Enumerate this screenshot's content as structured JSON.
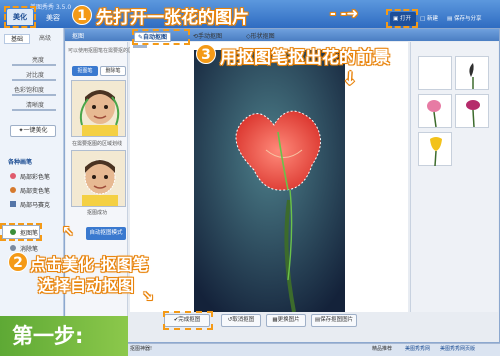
{
  "app": {
    "title": "美图秀秀 3.5.0",
    "open_label": "打开",
    "new_label": "新建",
    "share_label": "保存与分享"
  },
  "top_tabs": [
    {
      "label": "美化"
    },
    {
      "label": "美容"
    }
  ],
  "left_panel": {
    "subtabs": [
      "基础",
      "高级"
    ],
    "sliders": [
      "亮度",
      "对比度",
      "色彩饱和度",
      "清晰度"
    ],
    "one_click_label": "一键美化",
    "section_title": "各种画笔",
    "categories": [
      {
        "label": "局部彩色笔",
        "icon": "brush-icon"
      },
      {
        "label": "局部变色笔",
        "icon": "brush-icon"
      },
      {
        "label": "局部马赛克",
        "icon": "mosaic-icon"
      },
      {
        "label": "抠图笔",
        "icon": "cutout-pen-icon"
      },
      {
        "label": "消除笔",
        "icon": "eraser-icon"
      }
    ]
  },
  "dialog": {
    "title": "抠图",
    "hint": "可以使用抠图笔在需要抠的区域划线",
    "toggles": [
      "抠图笔",
      "删除笔"
    ],
    "sample_caption_1": "在需要抠图的区域划线",
    "sample_caption_2": "抠图成功",
    "auto_cut_label": "自动抠图模式",
    "tool_tabs": [
      "自动抠图",
      "手动抠图",
      "形状抠图"
    ],
    "bottom_buttons": [
      "完成抠图",
      "取消抠图",
      "更换图片",
      "保存抠图图片"
    ]
  },
  "status_bar": {
    "left": "抠图神器!",
    "items": [
      "精品推荐",
      "美图秀秀网",
      "美图秀秀网页版"
    ]
  },
  "annotations": {
    "step1": {
      "num": "1",
      "text": "先打开一张花的图片"
    },
    "step2": {
      "num": "2",
      "text_line1": "点击美化-抠图笔",
      "text_line2": "选择自动抠图"
    },
    "step3": {
      "num": "3",
      "text": "用抠图笔抠出花的前景"
    },
    "step_label": "第一步:"
  },
  "colors": {
    "accent": "#f49a17",
    "title_bar": "#2f6cc1",
    "step_green": "#6bb23b",
    "flower_red": "#e8413a"
  }
}
